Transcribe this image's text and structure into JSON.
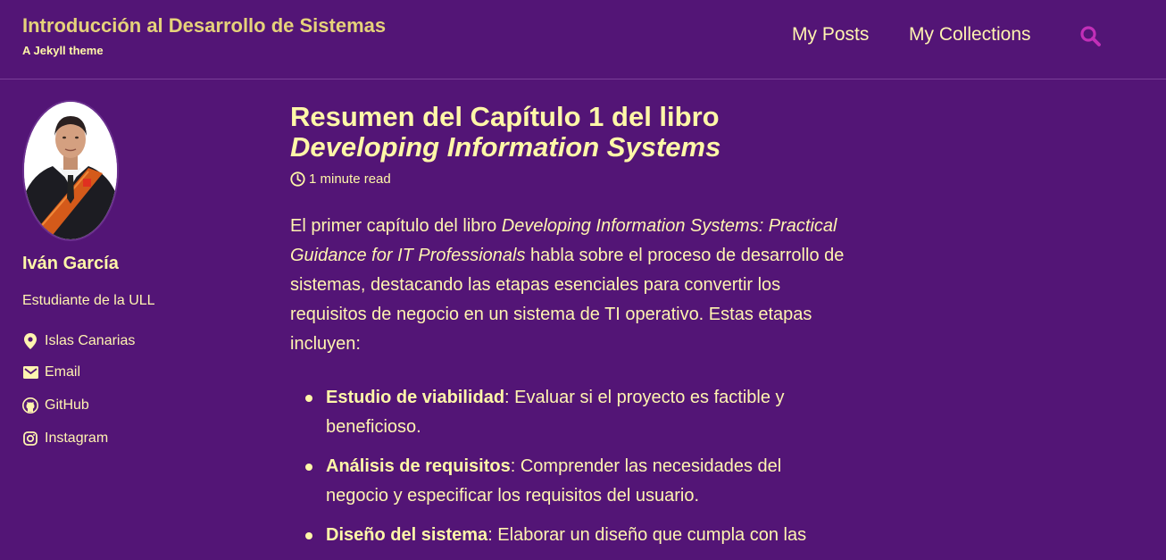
{
  "header": {
    "site_title": "Introducción al Desarrollo de Sistemas",
    "site_subtitle": "A Jekyll theme",
    "nav": [
      {
        "label": "My Posts"
      },
      {
        "label": "My Collections"
      }
    ],
    "search_icon": "search-icon"
  },
  "author": {
    "name": "Iván García",
    "bio": "Estudiante de la ULL",
    "links": [
      {
        "label": "Islas Canarias",
        "icon": "map-marker-icon"
      },
      {
        "label": "Email",
        "icon": "envelope-icon"
      },
      {
        "label": "GitHub",
        "icon": "github-icon"
      },
      {
        "label": "Instagram",
        "icon": "instagram-icon"
      }
    ]
  },
  "post": {
    "title_line1": "Resumen del Capítulo 1 del libro",
    "title_line2": "Developing Information Systems",
    "read_time": "1 minute read",
    "intro_start": "El primer capítulo del libro ",
    "intro_book": "Developing Information Systems: Practical Guidance for IT Professionals",
    "intro_rest": " habla sobre el proceso de desarrollo de sistemas, destacando las etapas esenciales para convertir los requisitos de negocio en un sistema de TI operativo. Estas etapas incluyen:",
    "stages": [
      {
        "term": "Estudio de viabilidad",
        "desc": ": Evaluar si el proyecto es factible y beneficioso."
      },
      {
        "term": "Análisis de requisitos",
        "desc": ": Comprender las necesidades del negocio y especificar los requisitos del usuario."
      },
      {
        "term": "Diseño del sistema",
        "desc": ": Elaborar un diseño que cumpla con las"
      }
    ]
  },
  "colors": {
    "background": "#531576",
    "title_yellow": "#fff7a8",
    "site_title_gold": "#e6d27a",
    "search_magenta": "#c22fb8"
  }
}
